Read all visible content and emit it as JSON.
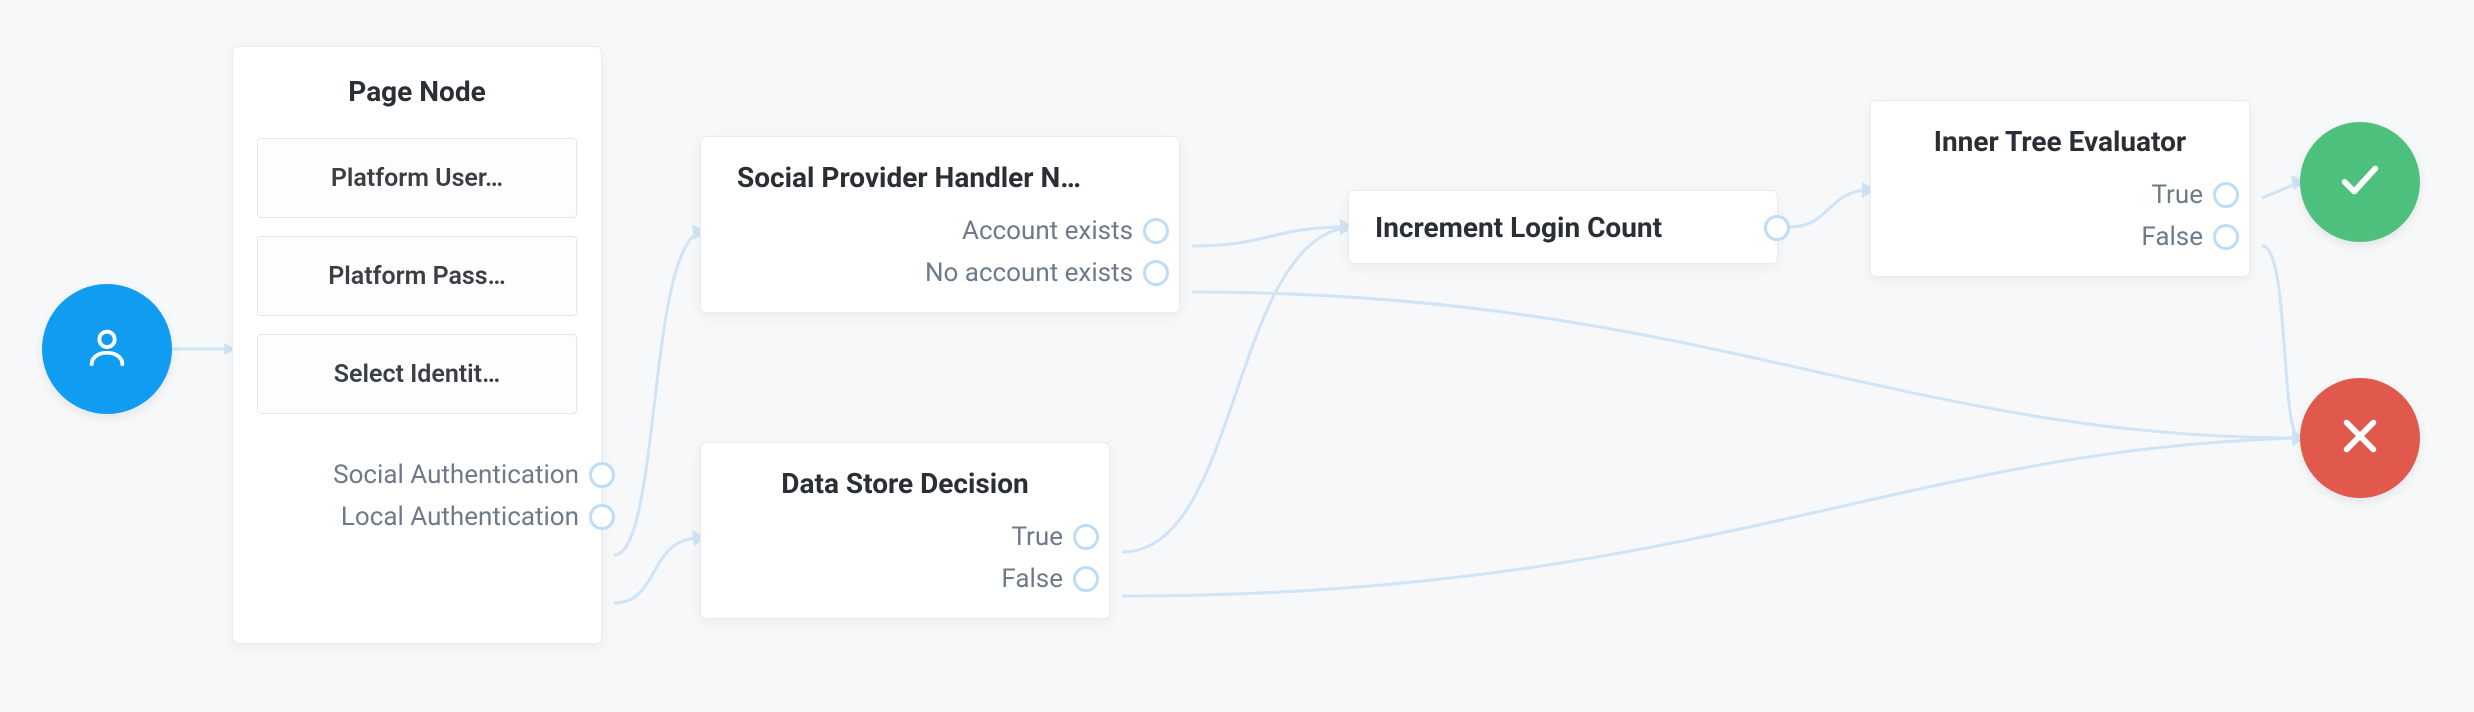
{
  "pageNode": {
    "title": "Page Node",
    "fields": [
      "Platform User…",
      "Platform Pass…",
      "Select Identit…"
    ],
    "outcomes": [
      "Social Authentication",
      "Local Authentication"
    ]
  },
  "socialHandler": {
    "title": "Social Provider Handler N…",
    "outcomes": [
      "Account exists",
      "No account exists"
    ]
  },
  "dataStore": {
    "title": "Data Store Decision",
    "outcomes": [
      "True",
      "False"
    ]
  },
  "incrementLogin": {
    "title": "Increment Login Count"
  },
  "innerTree": {
    "title": "Inner Tree Evaluator",
    "outcomes": [
      "True",
      "False"
    ]
  },
  "startNode": {
    "name": "start"
  },
  "successNode": {
    "name": "success"
  },
  "failNode": {
    "name": "failure"
  }
}
